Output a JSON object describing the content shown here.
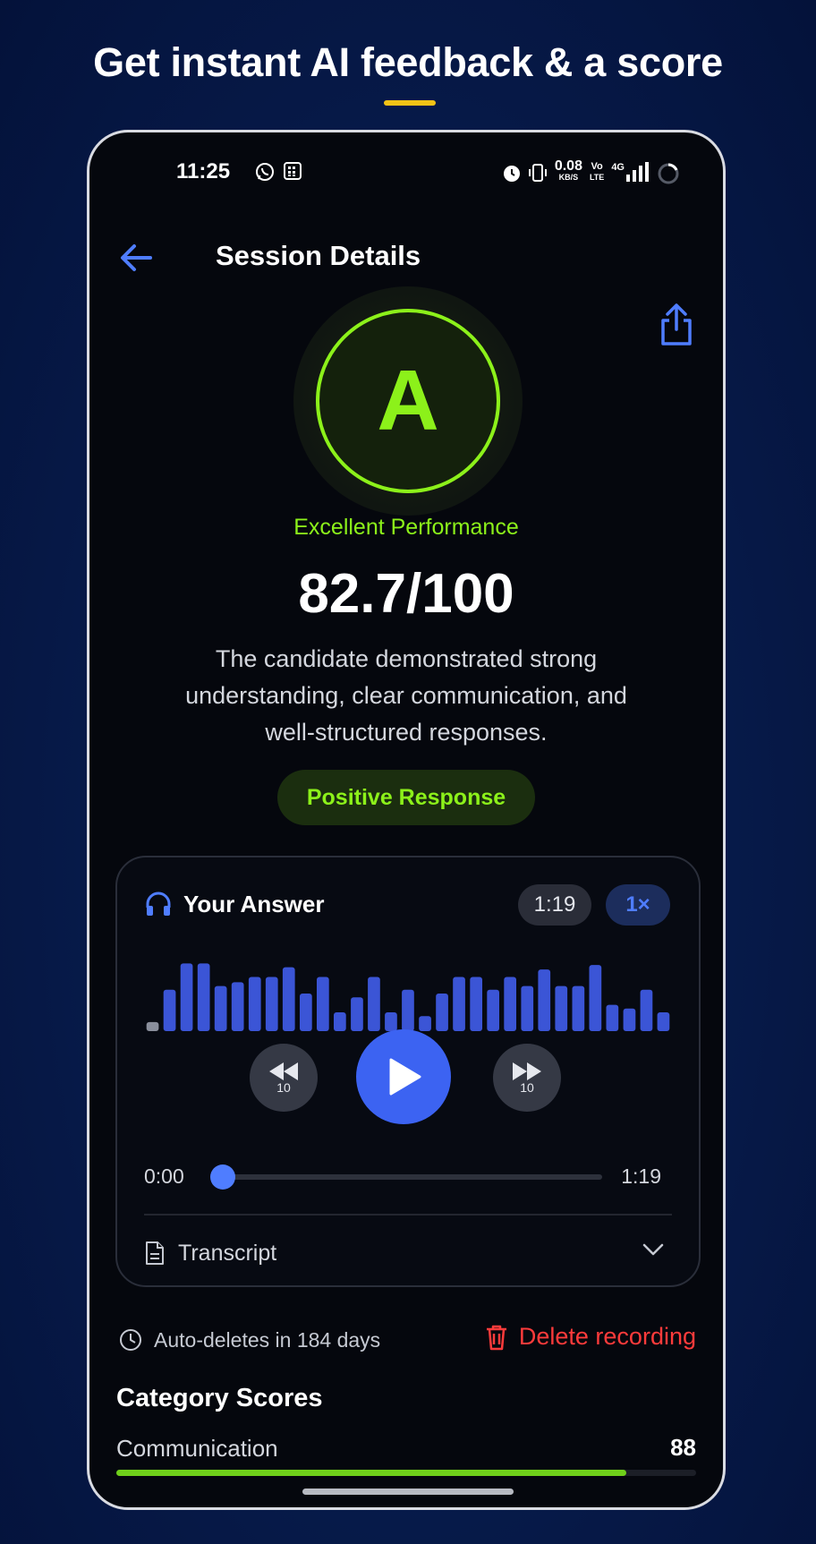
{
  "headline": "Get instant AI feedback & a score",
  "colors": {
    "accent_gold": "#f3c316",
    "grade_green": "#8cf11a",
    "brand_blue": "#4f7dff",
    "danger_red": "#ff3b3b"
  },
  "status_bar": {
    "time": "11:25",
    "left_icons": [
      "whatsapp-icon",
      "calendar-grid-icon"
    ],
    "right_icons": [
      "alarm-icon",
      "vibrate-icon",
      "data-speed-icon",
      "volte-icon",
      "signal-icon",
      "battery-ring-icon"
    ],
    "data_speed_value": "0.08",
    "data_speed_unit": "KB/S",
    "volte_top": "Vo",
    "volte_bottom": "LTE",
    "network": "4G"
  },
  "header": {
    "back_icon": "arrow-left-icon",
    "title": "Session Details",
    "share_icon": "share-icon"
  },
  "result": {
    "grade": "A",
    "performance_label": "Excellent Performance",
    "score": "82.7/100",
    "summary": "The candidate demonstrated strong understanding, clear communication, and well-structured responses.",
    "sentiment": "Positive Response"
  },
  "answer_card": {
    "icon": "headphones-icon",
    "title": "Your Answer",
    "duration": "1:19",
    "speed": "1×",
    "waveform_levels": [
      0.12,
      0.55,
      0.9,
      0.9,
      0.6,
      0.65,
      0.72,
      0.72,
      0.85,
      0.5,
      0.72,
      0.25,
      0.45,
      0.72,
      0.25,
      0.55,
      0.2,
      0.5,
      0.72,
      0.72,
      0.55,
      0.72,
      0.6,
      0.82,
      0.6,
      0.6,
      0.88,
      0.35,
      0.3,
      0.55,
      0.25
    ],
    "skip_back": {
      "icon": "rewind-icon",
      "seconds": "10"
    },
    "play_icon": "play-icon",
    "skip_forward": {
      "icon": "fast-forward-icon",
      "seconds": "10"
    },
    "current_time": "0:00",
    "total_time": "1:19",
    "progress": 0,
    "transcript_icon": "document-icon",
    "transcript_label": "Transcript",
    "transcript_chevron": "chevron-down-icon"
  },
  "retention": {
    "icon": "clock-icon",
    "text": "Auto-deletes in 184 days"
  },
  "delete": {
    "icon": "trash-icon",
    "label": "Delete recording"
  },
  "categories": {
    "title": "Category Scores",
    "items": [
      {
        "label": "Communication",
        "value": "88",
        "fraction": 0.88
      }
    ]
  }
}
